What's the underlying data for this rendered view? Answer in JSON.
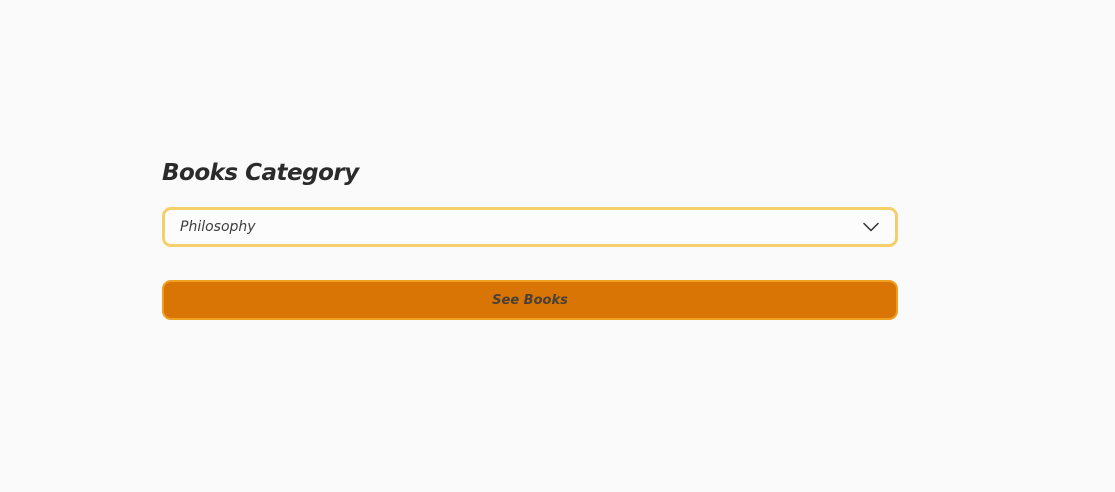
{
  "form": {
    "title": "Books Category",
    "category_select": {
      "selected_value": "Philosophy",
      "icon": "chevron-down-icon"
    },
    "submit_label": "See Books"
  },
  "colors": {
    "background": "#fafafa",
    "select_border": "#f5d06a",
    "button_fill": "#d87505",
    "button_border": "#f0a020",
    "title_text": "#2b2b2b"
  }
}
